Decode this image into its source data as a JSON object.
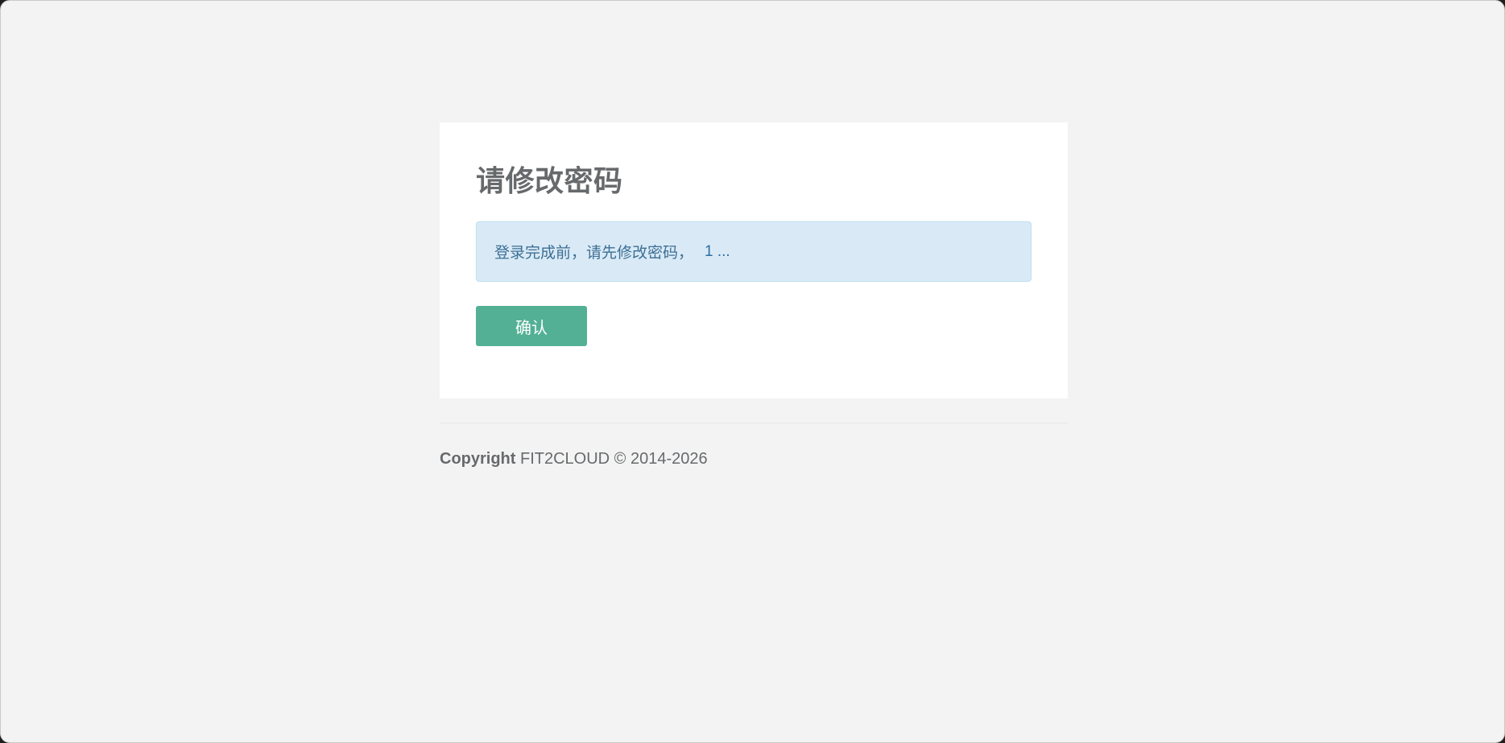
{
  "card": {
    "title": "请修改密码",
    "alert": {
      "message": "登录完成前，请先修改密码，",
      "countdown": "1 ..."
    },
    "confirm_label": "确认"
  },
  "footer": {
    "copyright_label": "Copyright",
    "copyright_text": "FIT2CLOUD © 2014-2026"
  },
  "colors": {
    "background": "#f3f3f3",
    "card": "#ffffff",
    "primary_button": "#53b095",
    "alert_background": "#d9eaf6",
    "alert_text": "#3d6f94",
    "title_text": "#676a6c"
  }
}
